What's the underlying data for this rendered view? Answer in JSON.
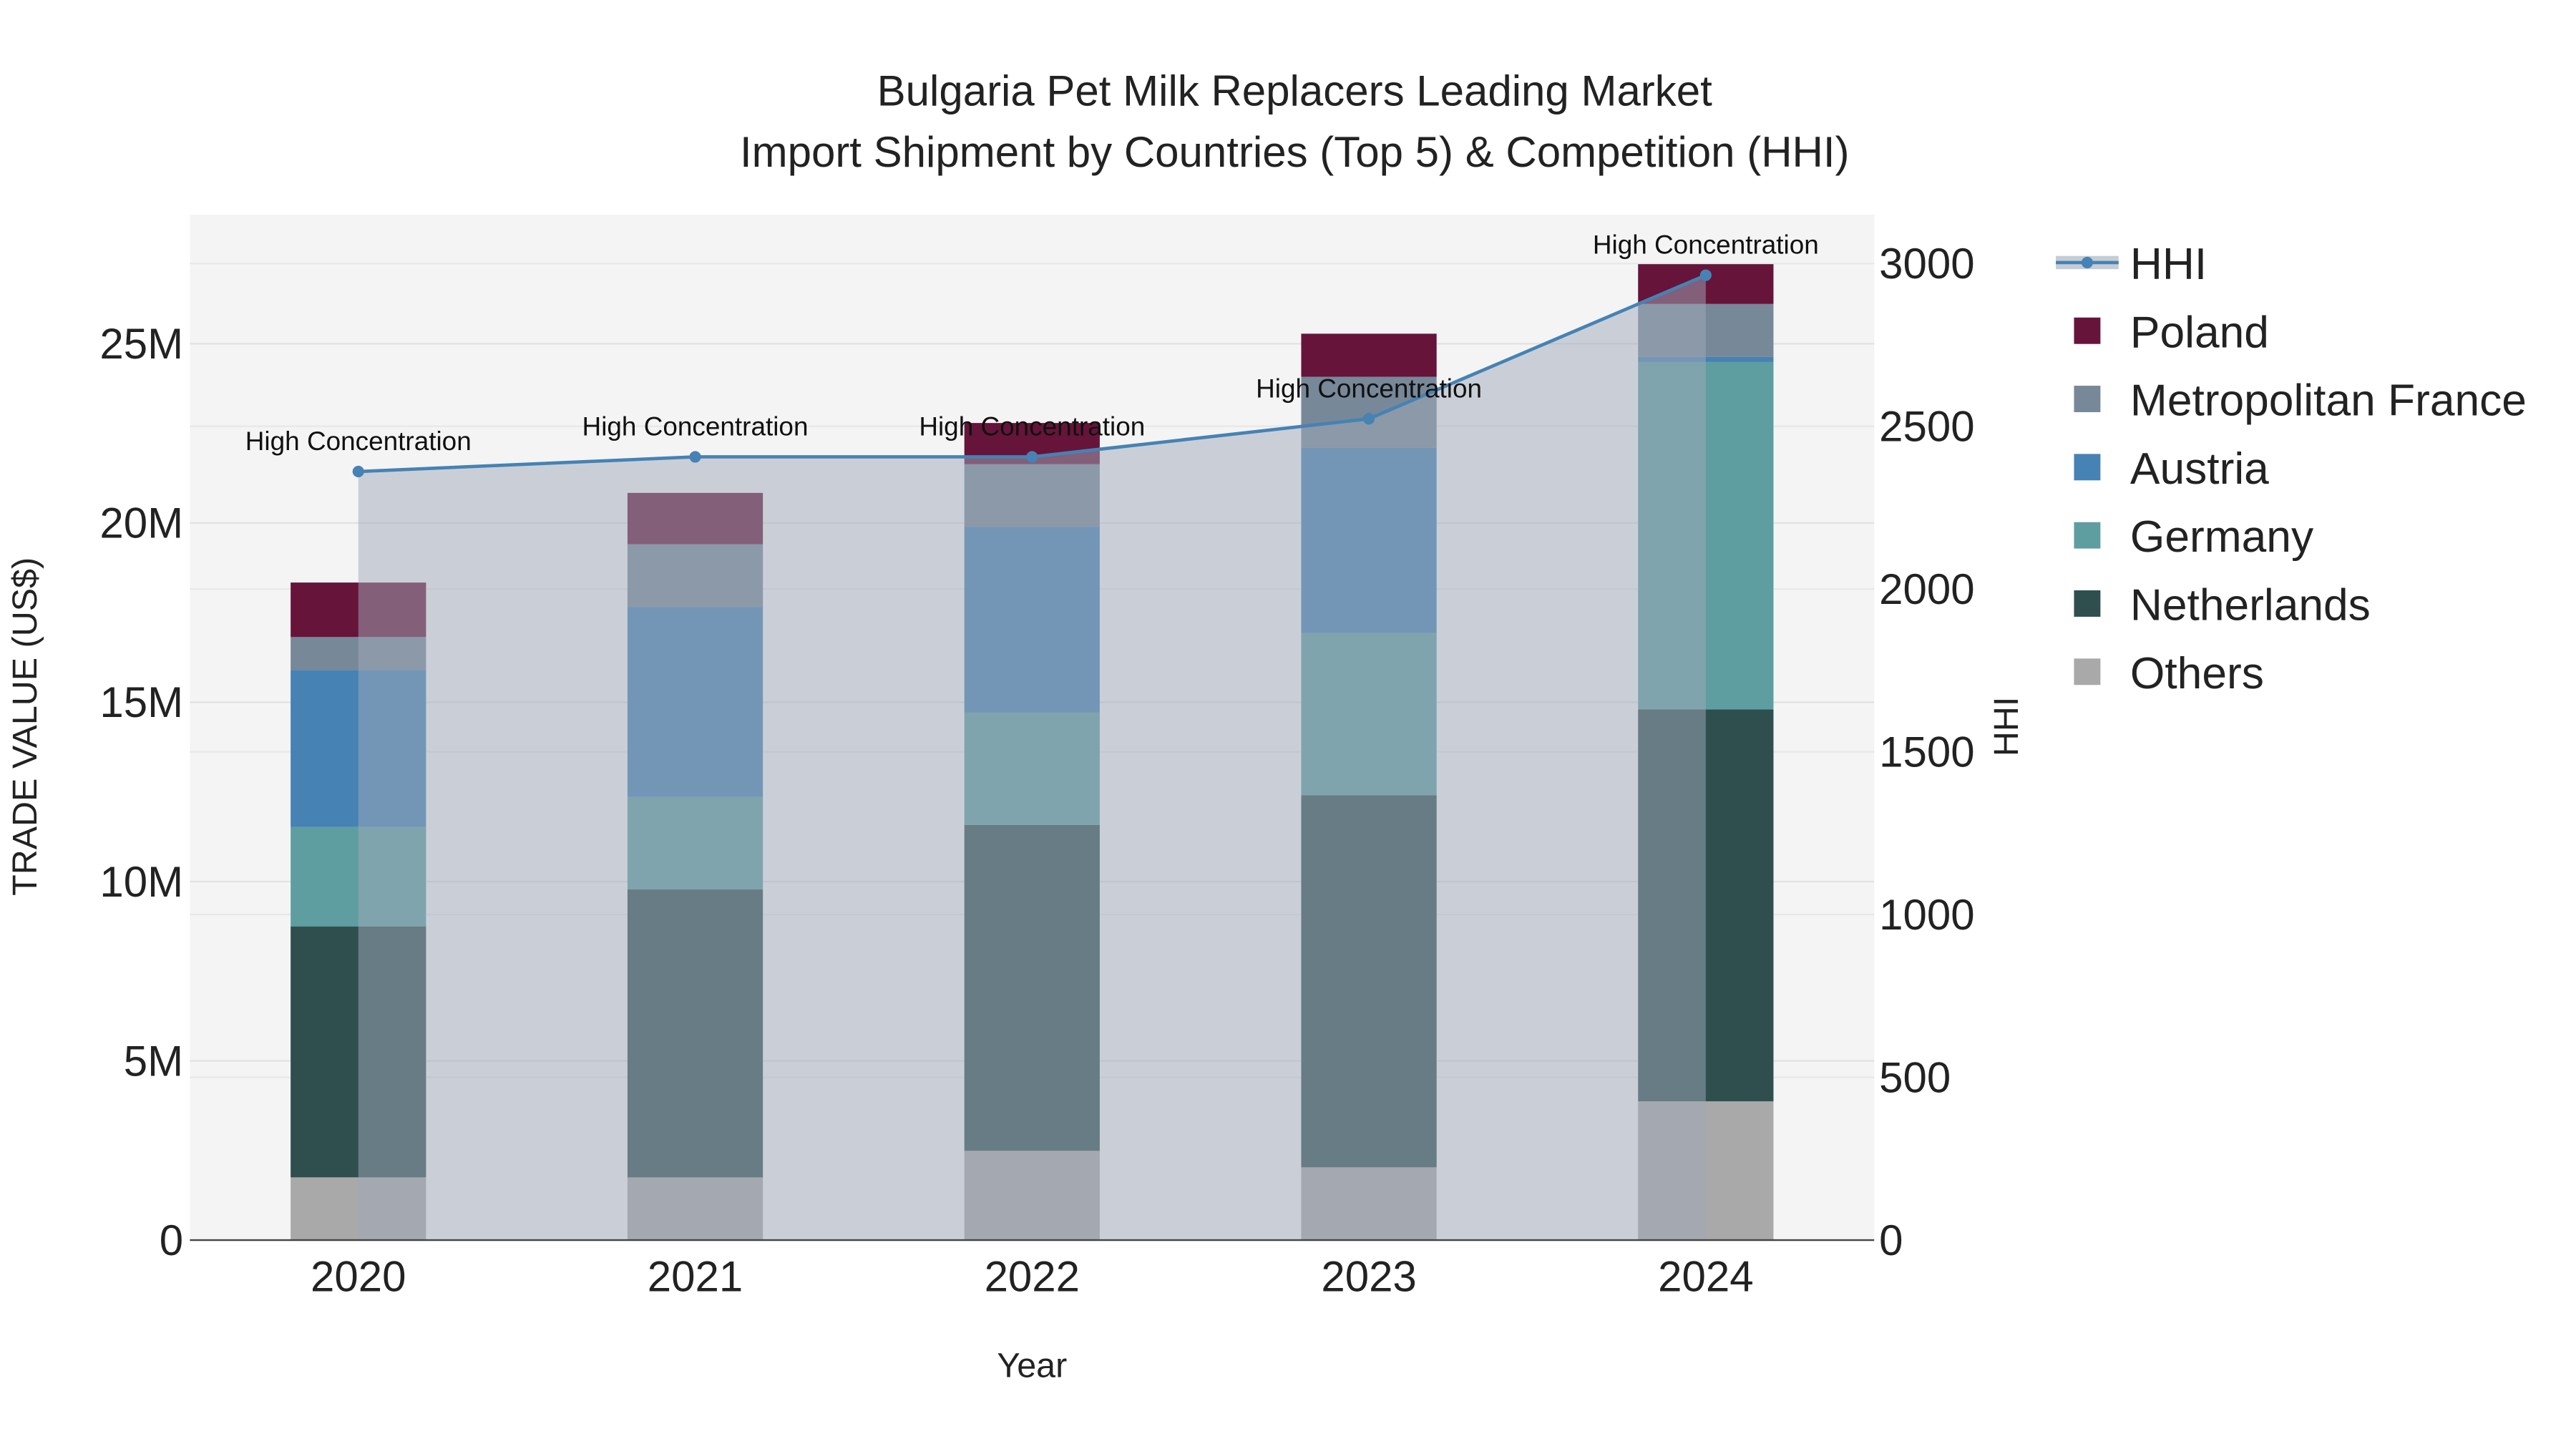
{
  "chart_data": {
    "type": "bar",
    "stacked": true,
    "title": "Bulgaria Pet Milk Replacers Leading Market",
    "subtitle": "Import Shipment by Countries (Top 5) & Competition (HHI)",
    "xlabel": "Year",
    "ylabel": "TRADE VALUE (US$)",
    "y2label": "HHI",
    "categories": [
      "2020",
      "2021",
      "2022",
      "2023",
      "2024"
    ],
    "ylim": [
      0,
      28600000
    ],
    "y2lim": [
      0,
      3150
    ],
    "yticks": [
      0,
      5000000,
      10000000,
      15000000,
      20000000,
      25000000
    ],
    "ytick_labels": [
      "0",
      "5M",
      "10M",
      "15M",
      "20M",
      "25M"
    ],
    "y2ticks": [
      0,
      500,
      1000,
      1500,
      2000,
      2500,
      3000
    ],
    "y2tick_labels": [
      "0",
      "500",
      "1000",
      "1500",
      "2000",
      "2500",
      "3000"
    ],
    "grid": true,
    "legend_position": "right",
    "series": [
      {
        "name": "Others",
        "color": "#a9a9a9",
        "values": [
          1750000,
          1750000,
          2490000,
          2030000,
          3870000
        ]
      },
      {
        "name": "Netherlands",
        "color": "#2f4f4f",
        "values": [
          7000000,
          8030000,
          9090000,
          10380000,
          10930000
        ]
      },
      {
        "name": "Germany",
        "color": "#5f9ea0",
        "values": [
          2770000,
          2580000,
          3140000,
          4520000,
          9690000
        ]
      },
      {
        "name": "Austria",
        "color": "#4682b4",
        "values": [
          4380000,
          5300000,
          5170000,
          5170000,
          140000
        ]
      },
      {
        "name": "Metropolitan France",
        "color": "#778899",
        "values": [
          920000,
          1750000,
          1750000,
          1980000,
          1480000
        ]
      },
      {
        "name": "Poland",
        "color": "#66143a",
        "values": [
          1520000,
          1430000,
          1150000,
          1200000,
          1110000
        ]
      }
    ],
    "line": {
      "name": "HHI",
      "color": "#4682b4",
      "axis": "y2",
      "values": [
        2361,
        2406,
        2406,
        2523,
        2964
      ]
    },
    "annotations": [
      "High Concentration",
      "High Concentration",
      "High Concentration",
      "High Concentration",
      "High Concentration"
    ],
    "legend_order": [
      "HHI",
      "Poland",
      "Metropolitan France",
      "Austria",
      "Germany",
      "Netherlands",
      "Others"
    ]
  }
}
